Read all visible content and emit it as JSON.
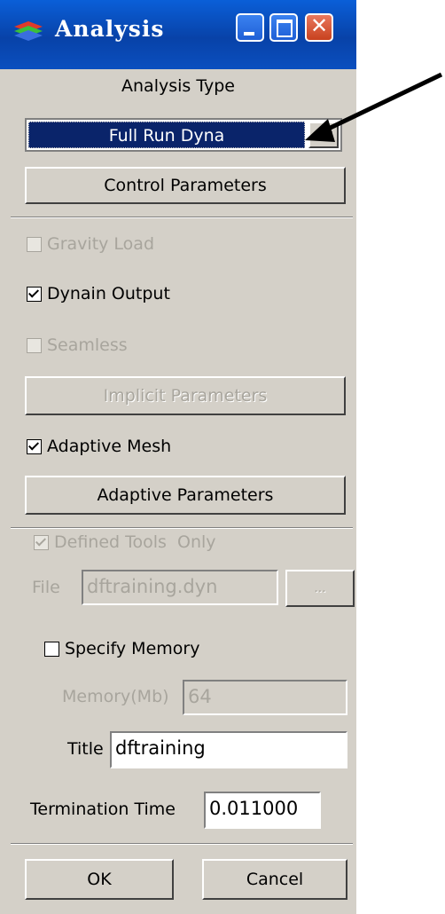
{
  "window": {
    "title": "Analysis"
  },
  "analysis_type": {
    "label": "Analysis Type",
    "selected": "Full Run Dyna"
  },
  "buttons": {
    "control_parameters": "Control Parameters",
    "implicit_parameters": "Implicit Parameters",
    "adaptive_parameters": "Adaptive Parameters",
    "browse": "...",
    "ok": "OK",
    "cancel": "Cancel"
  },
  "checkboxes": {
    "gravity_load": {
      "label": "Gravity Load",
      "checked": false,
      "enabled": false
    },
    "dynain_output": {
      "label": "Dynain Output",
      "checked": true,
      "enabled": true
    },
    "seamless": {
      "label": "Seamless",
      "checked": false,
      "enabled": false
    },
    "adaptive_mesh": {
      "label": "Adaptive Mesh",
      "checked": true,
      "enabled": true
    },
    "defined_tools_only": {
      "label": "Defined Tools  Only",
      "checked": true,
      "enabled": false
    },
    "specify_memory": {
      "label": "Specify Memory",
      "checked": false,
      "enabled": true
    }
  },
  "fields": {
    "file": {
      "label": "File",
      "value": "dftraining.dyn"
    },
    "memory": {
      "label": "Memory(Mb)",
      "value": "64"
    },
    "title": {
      "label": "Title",
      "value": "dftraining"
    },
    "termination_time": {
      "label": "Termination Time",
      "value": "0.011000"
    }
  },
  "colors": {
    "titlebar": "#0842a8",
    "selection": "#0a246a",
    "face": "#d4d0c8",
    "close_button": "#c8411e"
  }
}
